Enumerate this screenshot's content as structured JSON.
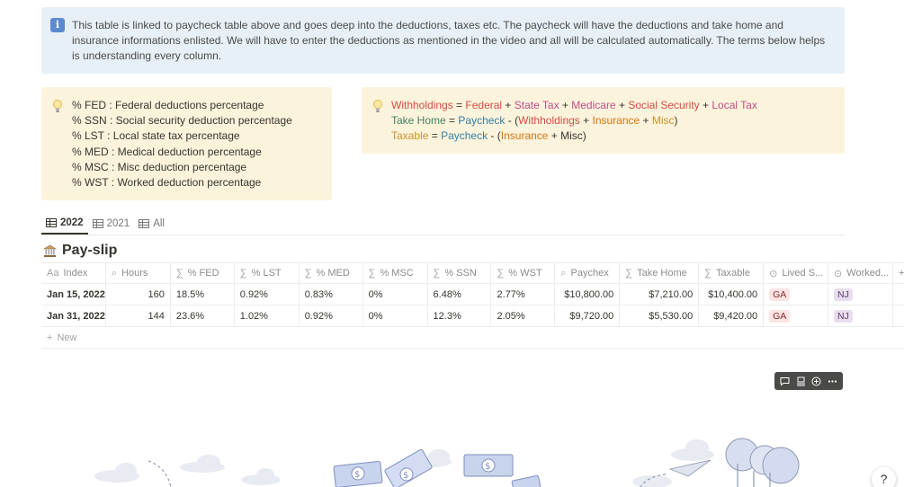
{
  "info_callout": {
    "icon": "info-icon",
    "text": "This table is linked to paycheck table above and goes deep into the deductions, taxes etc. The paycheck will have the deductions and take home and insurance informations enlisted. We will have to enter the deductions as mentioned in the video and all will be calculated automatically. The terms below helps is understanding every column."
  },
  "definitions_callout": {
    "icon": "lightbulb-icon",
    "lines": [
      "% FED : Federal deductions percentage",
      "% SSN : Social security deduction percentage",
      "% LST : Local state tax percentage",
      "% MED : Medical deduction percentage",
      "% MSC : Misc deduction percentage",
      "% WST : Worked deduction percentage"
    ]
  },
  "formula_callout": {
    "icon": "lightbulb-icon",
    "withholdings": {
      "label": "Withholdings",
      "eq": " = ",
      "federal": "Federal",
      "p1": " + ",
      "state_tax": "State Tax",
      "p2": " + ",
      "medicare": "Medicare",
      "p3": " + ",
      "social_security": "Social Security",
      "p4": " + ",
      "local_tax": "Local Tax"
    },
    "take_home": {
      "label": "Take Home",
      "eq": " = ",
      "paycheck": "Paycheck",
      "minus": " - (",
      "withholdings": "Withholdings",
      "p1": " + ",
      "insurance": "Insurance",
      "p2": " + ",
      "misc": "Misc",
      "close": ")"
    },
    "taxable": {
      "label": "Taxable",
      "eq": " = ",
      "paycheck": "Paycheck",
      "minus": " - (",
      "insurance": "Insurance",
      "rest": " + Misc)"
    }
  },
  "tabs": [
    {
      "label": "2022",
      "active": true
    },
    {
      "label": "2021",
      "active": false
    },
    {
      "label": "All",
      "active": false
    }
  ],
  "database": {
    "title": "Pay-slip",
    "icon": "bank-icon",
    "columns": [
      {
        "icon": "Aa",
        "label": "Index"
      },
      {
        "icon": "⌕",
        "label": "Hours"
      },
      {
        "icon": "∑",
        "label": "% FED"
      },
      {
        "icon": "∑",
        "label": "% LST"
      },
      {
        "icon": "∑",
        "label": "% MED"
      },
      {
        "icon": "∑",
        "label": "% MSC"
      },
      {
        "icon": "∑",
        "label": "% SSN"
      },
      {
        "icon": "∑",
        "label": "% WST"
      },
      {
        "icon": "⌕",
        "label": "Paychex"
      },
      {
        "icon": "∑",
        "label": "Take Home"
      },
      {
        "icon": "∑",
        "label": "Taxable"
      },
      {
        "icon": "⊙",
        "label": "Lived S..."
      },
      {
        "icon": "⊙",
        "label": "Worked..."
      }
    ],
    "rows": [
      {
        "index": "Jan 15, 2022",
        "hours": "160",
        "fed": "18.5%",
        "lst": "0.92%",
        "med": "0.83%",
        "msc": "0%",
        "ssn": "6.48%",
        "wst": "2.77%",
        "paychex": "$10,800.00",
        "take_home": "$7,210.00",
        "taxable": "$10,400.00",
        "lived": "GA",
        "worked": "NJ"
      },
      {
        "index": "Jan 31, 2022",
        "hours": "144",
        "fed": "23.6%",
        "lst": "1.02%",
        "med": "0.92%",
        "msc": "0%",
        "ssn": "12.3%",
        "wst": "2.05%",
        "paychex": "$9,720.00",
        "take_home": "$5,530.00",
        "taxable": "$9,420.00",
        "lived": "GA",
        "worked": "NJ"
      }
    ],
    "new_label": "New",
    "add_column": "+"
  },
  "help_label": "?",
  "colors": {
    "info_bg": "#e7f0f7",
    "callout_bg": "#fbf3db",
    "tag_ga": "#fbe4e4",
    "tag_nj": "#e8deee"
  }
}
